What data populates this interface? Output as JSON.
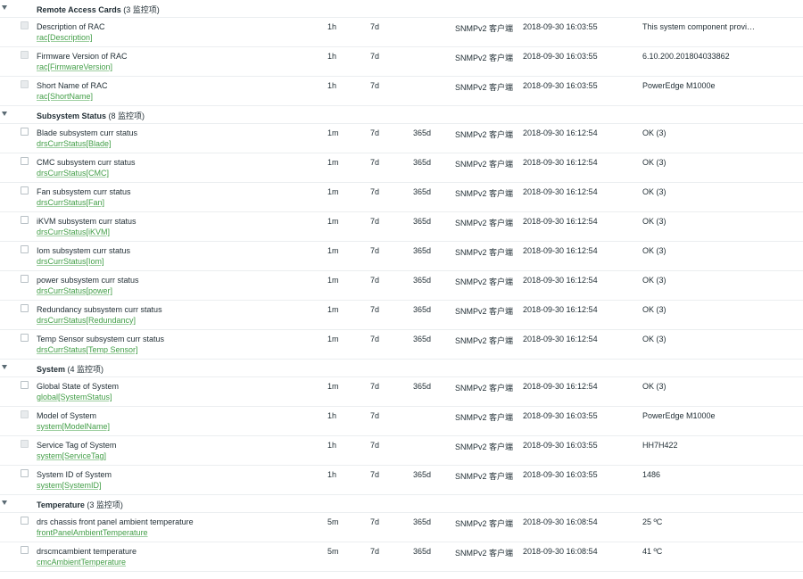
{
  "groups": [
    {
      "name": "Remote Access Cards",
      "count": "(3 监控项)",
      "items": [
        {
          "name": "Description of RAC",
          "key": "rac[Description]",
          "interval": "1h",
          "history": "7d",
          "trends": "",
          "type": "SNMPv2 客户端",
          "last_check": "2018-09-30 16:03:55",
          "last_value": "This system component provi…",
          "disabled": true
        },
        {
          "name": "Firmware Version of RAC",
          "key": "rac[FirmwareVersion]",
          "interval": "1h",
          "history": "7d",
          "trends": "",
          "type": "SNMPv2 客户端",
          "last_check": "2018-09-30 16:03:55",
          "last_value": "6.10.200.201804033862",
          "disabled": true
        },
        {
          "name": "Short Name of RAC",
          "key": "rac[ShortName]",
          "interval": "1h",
          "history": "7d",
          "trends": "",
          "type": "SNMPv2 客户端",
          "last_check": "2018-09-30 16:03:55",
          "last_value": "PowerEdge M1000e",
          "disabled": true
        }
      ]
    },
    {
      "name": "Subsystem Status",
      "count": "(8 监控项)",
      "items": [
        {
          "name": "Blade subsystem curr status",
          "key": "drsCurrStatus[Blade]",
          "interval": "1m",
          "history": "7d",
          "trends": "365d",
          "type": "SNMPv2 客户端",
          "last_check": "2018-09-30 16:12:54",
          "last_value": "OK (3)",
          "disabled": false
        },
        {
          "name": "CMC subsystem curr status",
          "key": "drsCurrStatus[CMC]",
          "interval": "1m",
          "history": "7d",
          "trends": "365d",
          "type": "SNMPv2 客户端",
          "last_check": "2018-09-30 16:12:54",
          "last_value": "OK (3)",
          "disabled": false
        },
        {
          "name": "Fan subsystem curr status",
          "key": "drsCurrStatus[Fan]",
          "interval": "1m",
          "history": "7d",
          "trends": "365d",
          "type": "SNMPv2 客户端",
          "last_check": "2018-09-30 16:12:54",
          "last_value": "OK (3)",
          "disabled": false
        },
        {
          "name": "iKVM subsystem curr status",
          "key": "drsCurrStatus[iKVM]",
          "interval": "1m",
          "history": "7d",
          "trends": "365d",
          "type": "SNMPv2 客户端",
          "last_check": "2018-09-30 16:12:54",
          "last_value": "OK (3)",
          "disabled": false
        },
        {
          "name": "Iom subsystem curr status",
          "key": "drsCurrStatus[Iom]",
          "interval": "1m",
          "history": "7d",
          "trends": "365d",
          "type": "SNMPv2 客户端",
          "last_check": "2018-09-30 16:12:54",
          "last_value": "OK (3)",
          "disabled": false
        },
        {
          "name": "power subsystem curr status",
          "key": "drsCurrStatus[power]",
          "interval": "1m",
          "history": "7d",
          "trends": "365d",
          "type": "SNMPv2 客户端",
          "last_check": "2018-09-30 16:12:54",
          "last_value": "OK (3)",
          "disabled": false
        },
        {
          "name": "Redundancy subsystem curr status",
          "key": "drsCurrStatus[Redundancy]",
          "interval": "1m",
          "history": "7d",
          "trends": "365d",
          "type": "SNMPv2 客户端",
          "last_check": "2018-09-30 16:12:54",
          "last_value": "OK (3)",
          "disabled": false
        },
        {
          "name": "Temp Sensor subsystem curr status",
          "key": "drsCurrStatus[Temp Sensor]",
          "interval": "1m",
          "history": "7d",
          "trends": "365d",
          "type": "SNMPv2 客户端",
          "last_check": "2018-09-30 16:12:54",
          "last_value": "OK (3)",
          "disabled": false
        }
      ]
    },
    {
      "name": "System",
      "count": "(4 监控项)",
      "items": [
        {
          "name": "Global State of System",
          "key": "global[SystemStatus]",
          "interval": "1m",
          "history": "7d",
          "trends": "365d",
          "type": "SNMPv2 客户端",
          "last_check": "2018-09-30 16:12:54",
          "last_value": "OK (3)",
          "disabled": false
        },
        {
          "name": "Model of System",
          "key": "system[ModelName]",
          "interval": "1h",
          "history": "7d",
          "trends": "",
          "type": "SNMPv2 客户端",
          "last_check": "2018-09-30 16:03:55",
          "last_value": "PowerEdge M1000e",
          "disabled": true
        },
        {
          "name": "Service Tag of System",
          "key": "system[ServiceTag]",
          "interval": "1h",
          "history": "7d",
          "trends": "",
          "type": "SNMPv2 客户端",
          "last_check": "2018-09-30 16:03:55",
          "last_value": "HH7H422",
          "disabled": true
        },
        {
          "name": "System ID of System",
          "key": "system[SystemID]",
          "interval": "1h",
          "history": "7d",
          "trends": "365d",
          "type": "SNMPv2 客户端",
          "last_check": "2018-09-30 16:03:55",
          "last_value": "1486",
          "disabled": false
        }
      ]
    },
    {
      "name": "Temperature",
      "count": "(3 监控项)",
      "items": [
        {
          "name": "drs chassis front panel ambient temperature",
          "key": "frontPanelAmbientTemperature",
          "interval": "5m",
          "history": "7d",
          "trends": "365d",
          "type": "SNMPv2 客户端",
          "last_check": "2018-09-30 16:08:54",
          "last_value": "25 ºC",
          "disabled": false
        },
        {
          "name": "drscmcambient temperature",
          "key": "cmcAmbientTemperature",
          "interval": "5m",
          "history": "7d",
          "trends": "365d",
          "type": "SNMPv2 客户端",
          "last_check": "2018-09-30 16:08:54",
          "last_value": "41 ºC",
          "disabled": false
        }
      ]
    }
  ]
}
